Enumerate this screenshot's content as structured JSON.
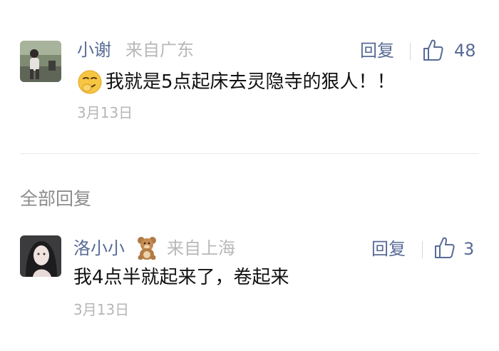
{
  "comments": [
    {
      "author": "小谢",
      "location": "来自广东",
      "reply_label": "回复",
      "likes": "48",
      "emoji_icon": "smirk-emoji-icon",
      "text": "我就是5点起床去灵隐寺的狠人！！",
      "date": "3月13日"
    }
  ],
  "section_title": "全部回复",
  "replies": [
    {
      "author": "洛小小",
      "badge_icon": "teddy-bear-icon",
      "location": "来自上海",
      "reply_label": "回复",
      "likes": "3",
      "text": "我4点半就起来了，卷起来",
      "date": "3月13日"
    }
  ],
  "colors": {
    "link": "#576b95",
    "muted": "#b8b8b8",
    "text": "#111111",
    "divider": "#e9e9e9"
  }
}
